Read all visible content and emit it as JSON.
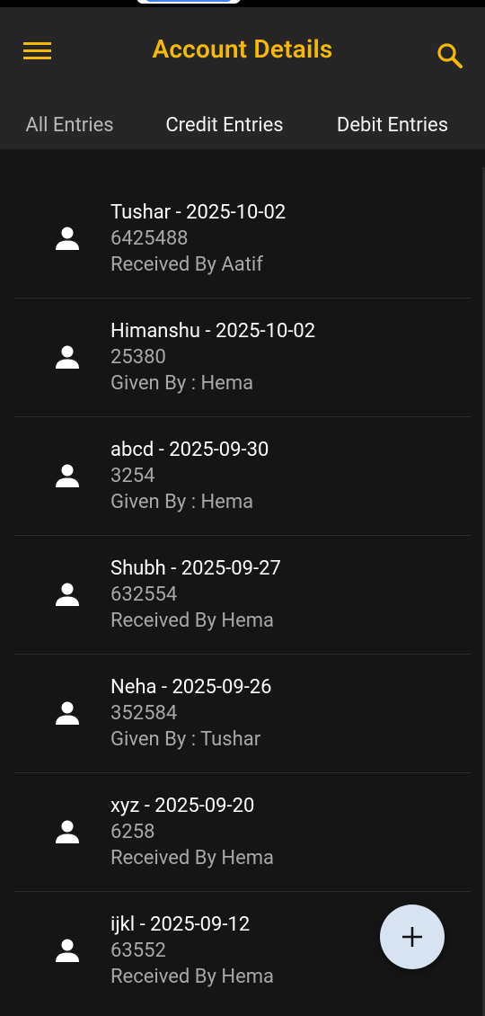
{
  "app_bar": {
    "title": "Account Details",
    "menu_icon": "hamburger-menu-icon",
    "search_icon": "search-icon"
  },
  "tabs": [
    {
      "label": "All Entries",
      "active": true
    },
    {
      "label": "Credit Entries",
      "active": false
    },
    {
      "label": "Debit Entries",
      "active": false
    }
  ],
  "entries": [
    {
      "title": "Tushar - 2025-10-02",
      "amount": "6425488",
      "note": "Received By Aatif"
    },
    {
      "title": "Himanshu - 2025-10-02",
      "amount": "25380",
      "note": "Given By : Hema"
    },
    {
      "title": "abcd - 2025-09-30",
      "amount": "3254",
      "note": "Given By : Hema"
    },
    {
      "title": "Shubh - 2025-09-27",
      "amount": "632554",
      "note": "Received By Hema"
    },
    {
      "title": "Neha - 2025-09-26",
      "amount": "352584",
      "note": "Given By : Tushar"
    },
    {
      "title": "xyz - 2025-09-20",
      "amount": "6258",
      "note": "Received By Hema"
    },
    {
      "title": "ijkl - 2025-09-12",
      "amount": "63552",
      "note": "Received By Hema"
    }
  ],
  "fab": {
    "icon": "plus-icon"
  },
  "colors": {
    "accent": "#f6b908",
    "app_bar_bg": "#262626",
    "list_bg": "#151515",
    "fab_bg": "#d7e3f0"
  }
}
